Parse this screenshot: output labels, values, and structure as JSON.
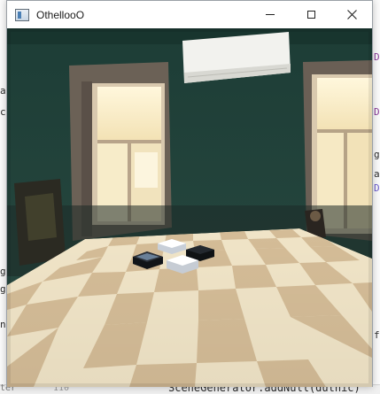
{
  "window": {
    "title": "OthellooO",
    "controls": [
      "minimize",
      "maximize",
      "close"
    ]
  },
  "scene": {
    "room": {
      "wall_color": "#20433b",
      "window_frame_color": "#c9b7a3",
      "floor_color": "#2a2420",
      "air_conditioner": "white"
    },
    "board": {
      "pattern": "checkerboard",
      "light_color": "#f0e4c7",
      "dark_color": "#d4bc97"
    },
    "pieces": [
      {
        "color": "white",
        "shape": "hexagon"
      },
      {
        "color": "black",
        "shape": "hexagon"
      },
      {
        "color": "black",
        "shape": "hexagon"
      },
      {
        "color": "white",
        "shape": "hexagon"
      }
    ]
  },
  "background_editor": {
    "fragments": [
      "D",
      "a",
      "ch",
      "D",
      "g",
      "a",
      "D",
      "a",
      "g",
      "g",
      "na",
      "f",
      "ter",
      "110",
      "SceneGenerator.addNull(dutnic)"
    ]
  }
}
